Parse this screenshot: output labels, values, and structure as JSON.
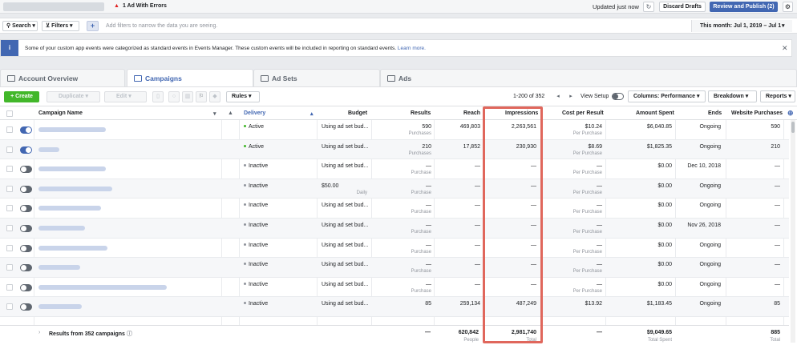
{
  "topbar": {
    "errors": "1 Ad With Errors",
    "updated": "Updated just now",
    "discard": "Discard Drafts",
    "publish": "Review and Publish (2)"
  },
  "filterbar": {
    "search": "Search",
    "filters": "Filters",
    "hint": "Add filters to narrow the data you are seeing.",
    "date_range": "This month: Jul 1, 2019 – Jul 1"
  },
  "notice": {
    "text": "Some of your custom app events were categorized as standard events in Events Manager. These custom events will be included in reporting on standard events.",
    "link": "Learn more."
  },
  "tabs": [
    "Account Overview",
    "Campaigns",
    "Ad Sets",
    "Ads"
  ],
  "toolbar": {
    "create": "Create",
    "duplicate": "Duplicate",
    "edit": "Edit",
    "rules": "Rules",
    "count": "1-200 of 352",
    "view_setup": "View Setup",
    "columns": "Columns: Performance",
    "breakdown": "Breakdown",
    "reports": "Reports"
  },
  "columns": {
    "name": "Campaign Name",
    "delivery": "Delivery",
    "budget": "Budget",
    "results": "Results",
    "reach": "Reach",
    "impressions": "Impressions",
    "cpr": "Cost per Result",
    "spent": "Amount Spent",
    "ends": "Ends",
    "wp": "Website Purchases"
  },
  "rows": [
    {
      "on": true,
      "delivery": "Active",
      "budget": "Using ad set bud...",
      "budget_sub": "",
      "results": "590",
      "results_sub": "Purchases",
      "reach": "469,803",
      "impressions": "2,263,561",
      "cpr": "$10.24",
      "cpr_sub": "Per Purchase",
      "spent": "$6,040.85",
      "ends": "Ongoing",
      "wp": "590"
    },
    {
      "on": true,
      "delivery": "Active",
      "budget": "Using ad set bud...",
      "budget_sub": "",
      "results": "210",
      "results_sub": "Purchases",
      "reach": "17,852",
      "impressions": "230,930",
      "cpr": "$8.69",
      "cpr_sub": "Per Purchase",
      "spent": "$1,825.35",
      "ends": "Ongoing",
      "wp": "210"
    },
    {
      "on": false,
      "delivery": "Inactive",
      "budget": "Using ad set bud...",
      "budget_sub": "",
      "results": "—",
      "results_sub": "Purchase",
      "reach": "—",
      "impressions": "—",
      "cpr": "—",
      "cpr_sub": "Per Purchase",
      "spent": "$0.00",
      "ends": "Dec 10, 2018",
      "wp": "—"
    },
    {
      "on": false,
      "delivery": "Inactive",
      "budget": "$50.00",
      "budget_sub": "Daily",
      "results": "—",
      "results_sub": "Purchase",
      "reach": "—",
      "impressions": "—",
      "cpr": "—",
      "cpr_sub": "Per Purchase",
      "spent": "$0.00",
      "ends": "Ongoing",
      "wp": "—"
    },
    {
      "on": false,
      "delivery": "Inactive",
      "budget": "Using ad set bud...",
      "budget_sub": "",
      "results": "—",
      "results_sub": "Purchase",
      "reach": "—",
      "impressions": "—",
      "cpr": "—",
      "cpr_sub": "Per Purchase",
      "spent": "$0.00",
      "ends": "Ongoing",
      "wp": "—"
    },
    {
      "on": false,
      "delivery": "Inactive",
      "budget": "Using ad set bud...",
      "budget_sub": "",
      "results": "—",
      "results_sub": "Purchase",
      "reach": "—",
      "impressions": "—",
      "cpr": "—",
      "cpr_sub": "Per Purchase",
      "spent": "$0.00",
      "ends": "Nov 26, 2018",
      "wp": "—"
    },
    {
      "on": false,
      "delivery": "Inactive",
      "budget": "Using ad set bud...",
      "budget_sub": "",
      "results": "—",
      "results_sub": "Purchase",
      "reach": "—",
      "impressions": "—",
      "cpr": "—",
      "cpr_sub": "Per Purchase",
      "spent": "$0.00",
      "ends": "Ongoing",
      "wp": "—"
    },
    {
      "on": false,
      "delivery": "Inactive",
      "budget": "Using ad set bud...",
      "budget_sub": "",
      "results": "—",
      "results_sub": "Purchase",
      "reach": "—",
      "impressions": "—",
      "cpr": "—",
      "cpr_sub": "Per Purchase",
      "spent": "$0.00",
      "ends": "Ongoing",
      "wp": "—"
    },
    {
      "on": false,
      "delivery": "Inactive",
      "budget": "Using ad set bud...",
      "budget_sub": "",
      "results": "—",
      "results_sub": "Purchase",
      "reach": "—",
      "impressions": "—",
      "cpr": "—",
      "cpr_sub": "Per Purchase",
      "spent": "$0.00",
      "ends": "Ongoing",
      "wp": "—"
    },
    {
      "on": false,
      "delivery": "Inactive",
      "budget": "Using ad set bud...",
      "budget_sub": "",
      "results": "85",
      "results_sub": "",
      "reach": "259,134",
      "impressions": "487,249",
      "cpr": "$13.92",
      "cpr_sub": "",
      "spent": "$1,183.45",
      "ends": "Ongoing",
      "wp": "85"
    }
  ],
  "footer": {
    "label": "Results from 352 campaigns",
    "results": "—",
    "reach": "620,842",
    "reach_sub": "People",
    "impressions": "2,981,740",
    "impressions_sub": "Total",
    "cpr": "—",
    "spent": "$9,049.65",
    "spent_sub": "Total Spent",
    "wp": "885",
    "wp_sub": "Total"
  },
  "colors": {
    "accent": "#4267b2",
    "create": "#42b72a",
    "active_dot": "#42b72a",
    "inactive_dot": "#90949c",
    "highlight": "#e0675c",
    "error": "#e02020"
  }
}
